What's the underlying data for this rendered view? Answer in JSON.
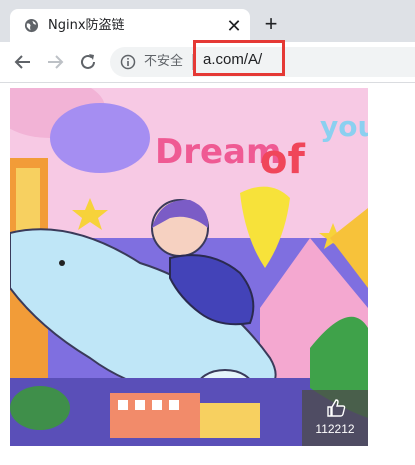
{
  "browser": {
    "tab": {
      "title": "Nginx防盗链",
      "close_label": "✕"
    },
    "new_tab_label": "+",
    "address_bar": {
      "security_label": "不安全",
      "url": "a.com/A/"
    }
  },
  "content": {
    "image": {
      "title_text": "Dream of you",
      "like_count": "112212"
    }
  },
  "colors": {
    "highlight_box": "#e53935",
    "tabstrip_bg": "#dee1e6",
    "omnibox_bg": "#f1f3f4"
  },
  "icons": [
    "globe-icon",
    "close-icon",
    "plus-icon",
    "back-arrow-icon",
    "forward-arrow-icon",
    "reload-icon",
    "info-icon",
    "thumbs-up-icon"
  ]
}
